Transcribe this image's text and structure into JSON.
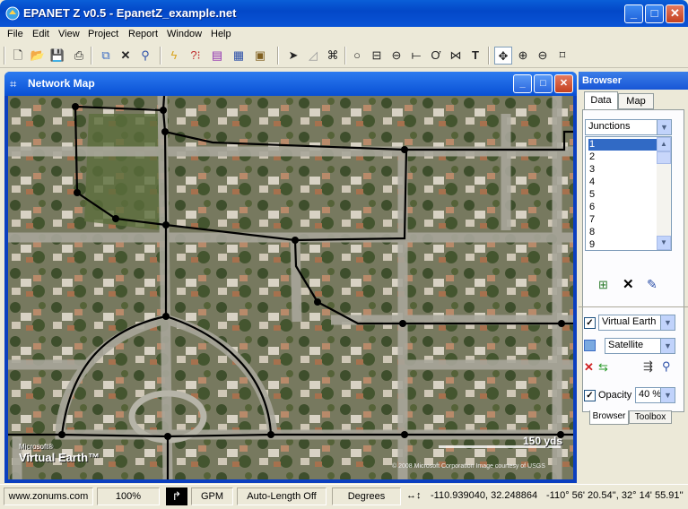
{
  "window": {
    "title": "EPANET Z v0.5 - EpanetZ_example.net"
  },
  "menu": [
    "File",
    "Edit",
    "View",
    "Project",
    "Report",
    "Window",
    "Help"
  ],
  "map_window": {
    "title": "Network Map",
    "scale_label": "150 yds",
    "logo_line1": "Microsoft®",
    "logo_line2": "Virtual Earth™",
    "copyright": "© 2008 Microsoft Corporation    Image courtesy of USGS"
  },
  "browser": {
    "title": "Browser",
    "tabs": [
      "Data",
      "Map"
    ],
    "category": "Junctions",
    "items": [
      "1",
      "2",
      "3",
      "4",
      "5",
      "6",
      "7",
      "8",
      "9"
    ],
    "selected_item": "1",
    "basemap": "Virtual Earth",
    "basemap_checked": true,
    "imagery": "Satellite",
    "opacity_label": "Opacity",
    "opacity_value": "40 %",
    "opacity_checked": true,
    "bottom_tabs": [
      "Browser",
      "Toolbox"
    ]
  },
  "status": {
    "website": "www.zonums.com",
    "zoom": "100%",
    "flow_units": "GPM",
    "auto_length": "Auto-Length Off",
    "coord_units": "Degrees",
    "decimal_coords": "-110.939040, 32.248864",
    "dms_coords": "-110° 56' 20.54'', 32° 14' 55.91''"
  },
  "colors": {
    "titlebar": "#0348c8",
    "accent": "#316ac5",
    "pipe": "#000000"
  }
}
